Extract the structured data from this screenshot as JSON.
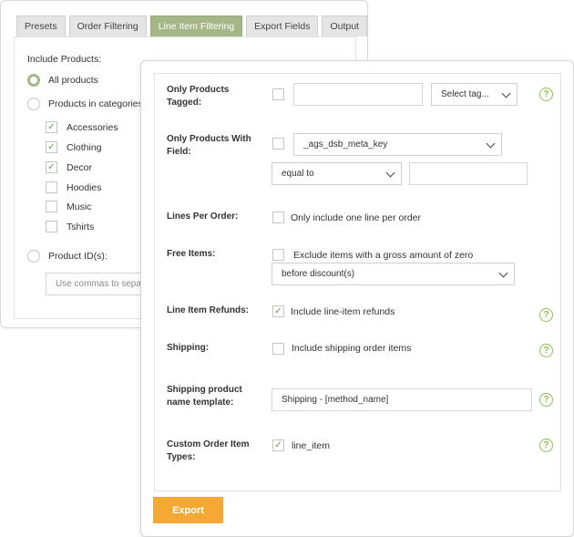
{
  "tabs": [
    {
      "label": "Presets"
    },
    {
      "label": "Order Filtering"
    },
    {
      "label": "Line Item Filtering"
    },
    {
      "label": "Export Fields"
    },
    {
      "label": "Output"
    }
  ],
  "product_filter": {
    "title": "Include Products:",
    "options": [
      {
        "label": "All products",
        "checked": true
      },
      {
        "label": "Products in categories",
        "checked": false
      },
      {
        "label": "Product ID(s):",
        "checked": false
      }
    ],
    "categories": [
      {
        "label": "Accessories",
        "checked": true
      },
      {
        "label": "Clothing",
        "checked": true
      },
      {
        "label": "Decor",
        "checked": true
      },
      {
        "label": "Hoodies",
        "checked": false
      },
      {
        "label": "Music",
        "checked": false
      },
      {
        "label": "Tshirts",
        "checked": false
      }
    ],
    "product_ids_placeholder": "Use commas to separa"
  },
  "line_items": {
    "only_tagged": {
      "label": "Only Products Tagged:",
      "tag_select": "Select tag..."
    },
    "with_field": {
      "label": "Only Products With Field:",
      "field_select": "_ags_dsb_meta_key",
      "operator_select": "equal to"
    },
    "lines_per_order": {
      "label": "Lines Per Order:",
      "checkbox_label": "Only include one line per order"
    },
    "free_items": {
      "label": "Free Items:",
      "checkbox_label": "Exclude items with a gross amount of zero",
      "discount_select": "before discount(s)"
    },
    "refunds": {
      "label": "Line Item Refunds:",
      "checkbox_label": "Include line-item refunds"
    },
    "shipping": {
      "label": "Shipping:",
      "checkbox_label": "Include shipping order items"
    },
    "shipping_template": {
      "label": "Shipping product name template:",
      "value": "Shipping - [method_name]"
    },
    "custom_types": {
      "label": "Custom Order Item Types:",
      "checkbox_label": "line_item"
    }
  },
  "export_button": "Export",
  "help_icon_symbol": "?",
  "check_symbol": "✓",
  "colors": {
    "accent_green": "#a5b787",
    "check_green": "#6f9a4c",
    "help_green": "#8fbe55",
    "export_orange": "#f5a833"
  }
}
